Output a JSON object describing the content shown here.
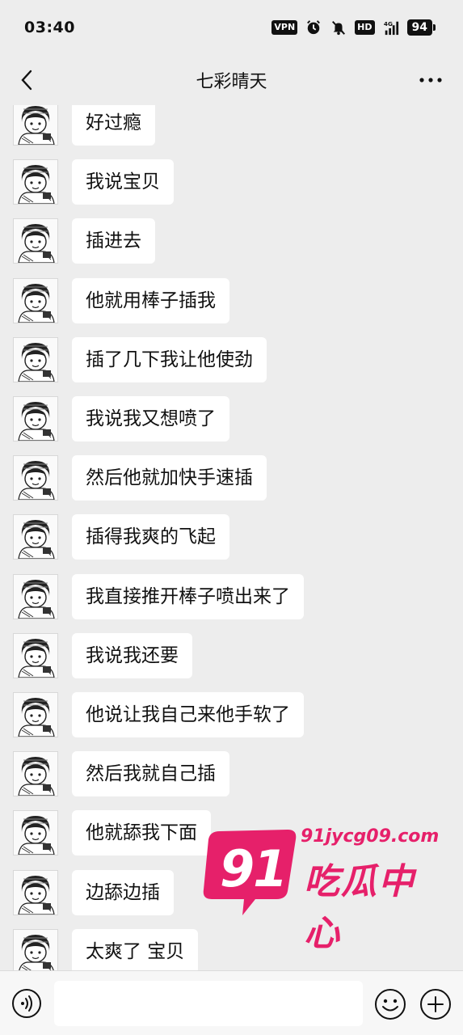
{
  "status_bar": {
    "time": "03:40",
    "vpn": "VPN",
    "hd": "HD",
    "network": "4G",
    "battery": "94"
  },
  "nav": {
    "title": "七彩晴天"
  },
  "messages": [
    "好过瘾",
    "我说宝贝",
    "插进去",
    "他就用棒子插我",
    "插了几下我让他使劲",
    "我说我又想喷了",
    "然后他就加快手速插",
    "插得我爽的飞起",
    "我直接推开棒子喷出来了",
    "我说我还要",
    "他说让我自己来他手软了",
    "然后我就自己插",
    "他就舔我下面",
    "边舔边插",
    "太爽了 宝贝"
  ],
  "watermark": {
    "number": "91",
    "url": "91jycg09.com",
    "text": "吃瓜中心",
    "color": "#e6206a"
  },
  "input_bar": {
    "value": ""
  },
  "colors": {
    "background": "#ededed",
    "bubble": "#ffffff",
    "input_bar": "#f7f7f7"
  }
}
